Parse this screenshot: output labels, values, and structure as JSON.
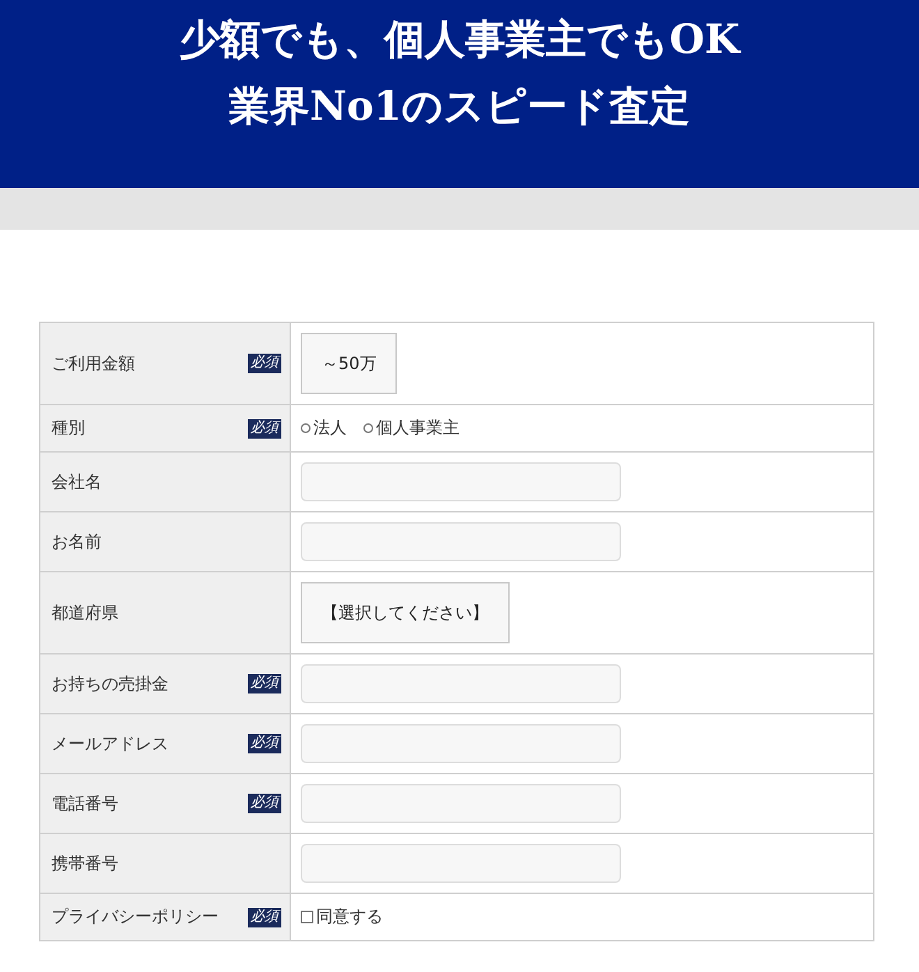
{
  "header": {
    "lines": [
      "少額でも、個人事業主でもOK",
      "業界No1のスピード査定"
    ]
  },
  "form": {
    "rows": [
      {
        "label": "ご利用金額",
        "required_badge": "必須",
        "kind": "select",
        "value": "～50万"
      },
      {
        "label": "種別",
        "required_badge": "必須",
        "kind": "radio",
        "options": [
          {
            "label": "法人",
            "selected": false
          },
          {
            "label": "個人事業主",
            "selected": false
          }
        ]
      },
      {
        "label": "会社名",
        "kind": "text"
      },
      {
        "label": "お名前",
        "kind": "text"
      },
      {
        "label": "都道府県",
        "kind": "select",
        "value": "【選択してください】"
      },
      {
        "label": "お持ちの売掛金",
        "required_badge": "必須",
        "kind": "text"
      },
      {
        "label": "メールアドレス",
        "required_badge": "必須",
        "kind": "text"
      },
      {
        "label": "電話番号",
        "required_badge": "必須",
        "kind": "text"
      },
      {
        "label": "携帯番号",
        "kind": "text"
      },
      {
        "label": "プライバシーポリシー",
        "required_badge": "必須",
        "kind": "checkbox",
        "text": "同意する",
        "checked": false
      }
    ]
  }
}
